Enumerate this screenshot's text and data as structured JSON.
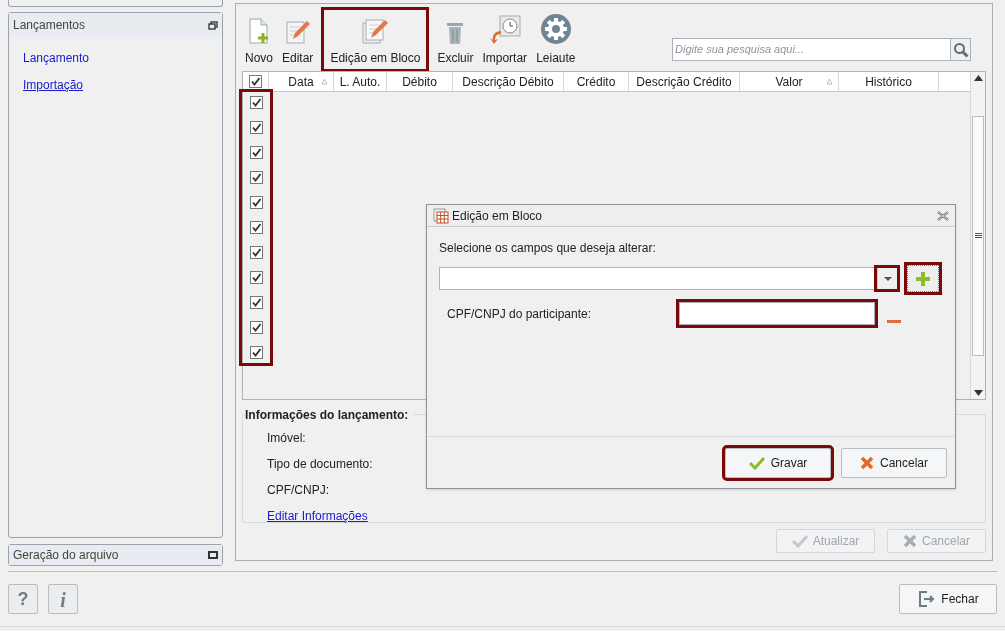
{
  "sidebar": {
    "panels": [
      {
        "title": "Lançamentos",
        "expanded": true,
        "items": [
          {
            "label": "Lançamento",
            "underlined": false
          },
          {
            "label": "Importação",
            "underlined": true
          }
        ]
      },
      {
        "title": "Geração do arquivo",
        "expanded": false
      }
    ]
  },
  "toolbar": [
    {
      "label": "Novo",
      "kind": "new",
      "highlighted": false
    },
    {
      "label": "Editar",
      "kind": "edit",
      "highlighted": false
    },
    {
      "label": "Edição em Bloco",
      "kind": "bulk",
      "highlighted": true
    },
    {
      "label": "Excluir",
      "kind": "delete",
      "highlighted": false
    },
    {
      "label": "Importar",
      "kind": "import",
      "highlighted": false
    },
    {
      "label": "Leiaute",
      "kind": "layout",
      "highlighted": false
    }
  ],
  "search": {
    "placeholder": "Digite sua pesquisa aqui..."
  },
  "table": {
    "select_all": {
      "checked": true
    },
    "checkbox_column_highlighted": true,
    "columns": [
      {
        "label": "Data",
        "sort_indicator": true
      },
      {
        "label": "L. Auto.",
        "sort_indicator": false
      },
      {
        "label": "Débito",
        "sort_indicator": false
      },
      {
        "label": "Descrição Débito",
        "sort_indicator": false
      },
      {
        "label": "Crédito",
        "sort_indicator": false
      },
      {
        "label": "Descrição Crédito",
        "sort_indicator": false
      },
      {
        "label": "Valor",
        "sort_indicator": true
      },
      {
        "label": "Histórico",
        "sort_indicator": false
      }
    ],
    "rows": [
      {
        "checked": true
      },
      {
        "checked": true
      },
      {
        "checked": true
      },
      {
        "checked": true
      },
      {
        "checked": true
      },
      {
        "checked": true
      },
      {
        "checked": true
      },
      {
        "checked": true
      },
      {
        "checked": true
      },
      {
        "checked": true
      },
      {
        "checked": true
      }
    ]
  },
  "info": {
    "title": "Informações do lançamento:",
    "labels": [
      "Imóvel:",
      "Tipo de documento:",
      "CPF/CNPJ:"
    ],
    "link": "Editar Informações"
  },
  "actions": [
    {
      "label": "Atualizar",
      "kind": "save",
      "disabled": true
    },
    {
      "label": "Cancelar",
      "kind": "cancel",
      "disabled": true
    }
  ],
  "footer": {
    "help": "?",
    "info": "i",
    "close": "Fechar"
  },
  "dialog": {
    "title": "Edição em Bloco",
    "prompt": "Selecione os campos que deseja alterar:",
    "dropdown_highlighted": true,
    "add_highlighted": true,
    "fields": [
      {
        "label": "CPF/CNPJ do participante:",
        "highlighted": true
      }
    ],
    "buttons": [
      {
        "label": "Gravar",
        "kind": "save",
        "highlighted": true
      },
      {
        "label": "Cancelar",
        "kind": "cancel",
        "highlighted": false
      }
    ]
  }
}
